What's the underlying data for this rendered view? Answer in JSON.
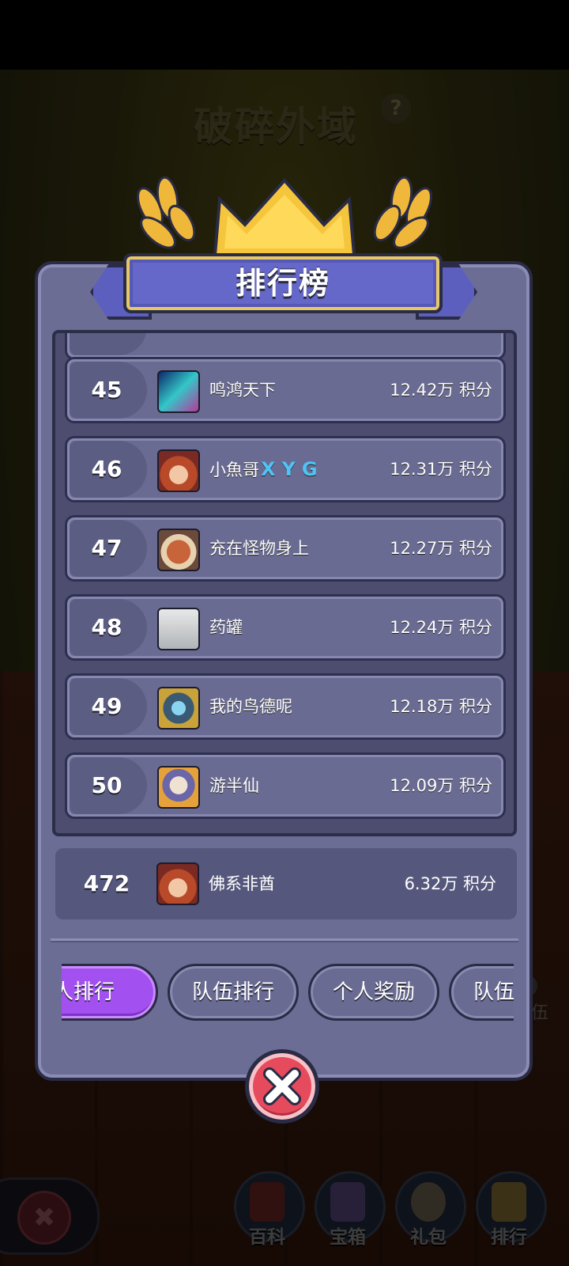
{
  "background": {
    "title": "破碎外域",
    "help": "?",
    "side_label": "伍",
    "nav": [
      {
        "label": "百科",
        "icon": "book-icon"
      },
      {
        "label": "宝箱",
        "icon": "chest-icon"
      },
      {
        "label": "礼包",
        "icon": "gift-bag-icon"
      },
      {
        "label": "排行",
        "icon": "trophy-icon"
      }
    ]
  },
  "dialog": {
    "title": "排行榜",
    "rows": [
      {
        "rank": "45",
        "name": "鸣鸿天下",
        "tag": "",
        "score": "12.42万 积分"
      },
      {
        "rank": "46",
        "name": "小魚哥",
        "tag": "XYG",
        "score": "12.31万 积分"
      },
      {
        "rank": "47",
        "name": "充在怪物身上",
        "tag": "",
        "score": "12.27万 积分"
      },
      {
        "rank": "48",
        "name": "药罐",
        "tag": "",
        "score": "12.24万 积分"
      },
      {
        "rank": "49",
        "name": "我的鸟德呢",
        "tag": "",
        "score": "12.18万 积分"
      },
      {
        "rank": "50",
        "name": "游半仙",
        "tag": "",
        "score": "12.09万 积分"
      }
    ],
    "self": {
      "rank": "472",
      "name": "佛系非酋",
      "score": "6.32万 积分"
    },
    "tabs": [
      "个人排行",
      "队伍排行",
      "个人奖励",
      "队伍奖励"
    ],
    "active_tab": "个人排行"
  },
  "colors": {
    "accent_active_tab": "#a350f0",
    "close_button": "#e64b5d",
    "tag_text": "#4fc4f4"
  }
}
